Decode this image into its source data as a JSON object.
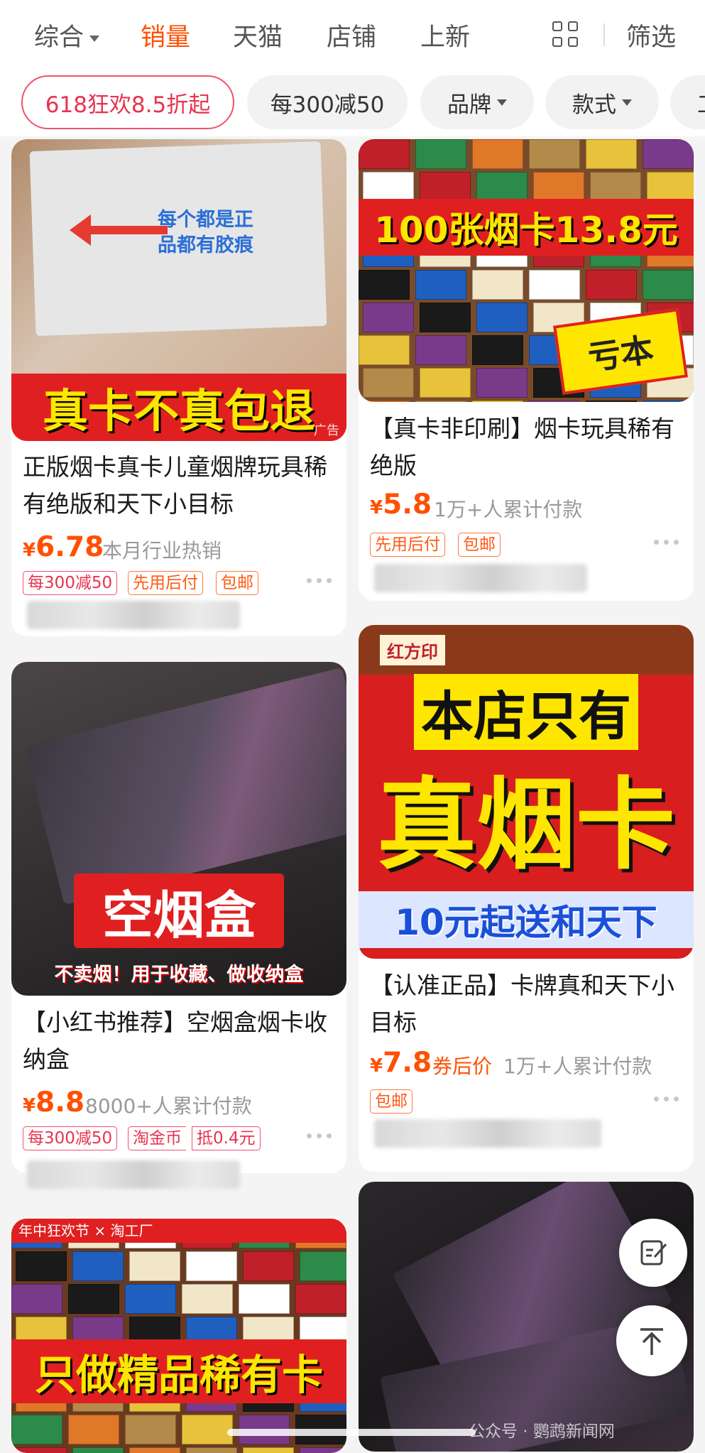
{
  "sort_bar": {
    "items": [
      "综合",
      "销量",
      "天猫",
      "店铺",
      "上新"
    ],
    "active_index": 1,
    "filter_label": "筛选"
  },
  "filter_pills": [
    "618狂欢8.5折起",
    "每300减50",
    "品牌",
    "款式",
    "工"
  ],
  "products": [
    {
      "image_text": [
        "每个都是正",
        "品都有胶痕",
        "真卡不真包退"
      ],
      "ad_label": "广告",
      "title": "正版烟卡真卡儿童烟牌玩具稀有绝版和天下小目标",
      "yen": "¥",
      "price": "6.78",
      "note": "本月行业热销",
      "tags": [
        "每300减50",
        "先用后付",
        "包邮"
      ]
    },
    {
      "image_text": [
        "100张烟卡13.8元",
        "亏本"
      ],
      "title": "【真卡非印刷】烟卡玩具稀有绝版",
      "yen": "¥",
      "price": "5.8",
      "note": "1万+人累计付款",
      "tags": [
        "先用后付",
        "包邮"
      ]
    },
    {
      "image_text": [
        "空烟盒",
        "不卖烟！用于收藏、做收纳盒"
      ],
      "title": "【小红书推荐】空烟盒烟卡收纳盒",
      "yen": "¥",
      "price": "8.8",
      "note": "8000+人累计付款",
      "tags": [
        "每300减50",
        "淘金币",
        "抵0.4元"
      ]
    },
    {
      "image_text": [
        "红方印",
        "本店只有",
        "真烟卡",
        "10元起送和天下"
      ],
      "title": "【认准正品】卡牌真和天下小目标",
      "yen": "¥",
      "price": "7.8",
      "price_note": "券后价",
      "note": "1万+人累计付款",
      "tags": [
        "包邮"
      ]
    },
    {
      "image_text": [
        "年中狂欢节 × 淘工厂",
        "只做精品稀有卡"
      ]
    },
    {
      "image_text": []
    }
  ],
  "watermark": "公众号 · 鹦鹉新闻网",
  "colors": {
    "accent": "#ff5000",
    "promo_red": "#e8334f",
    "banner_yellow": "#ffe600",
    "banner_red": "#e02020"
  }
}
